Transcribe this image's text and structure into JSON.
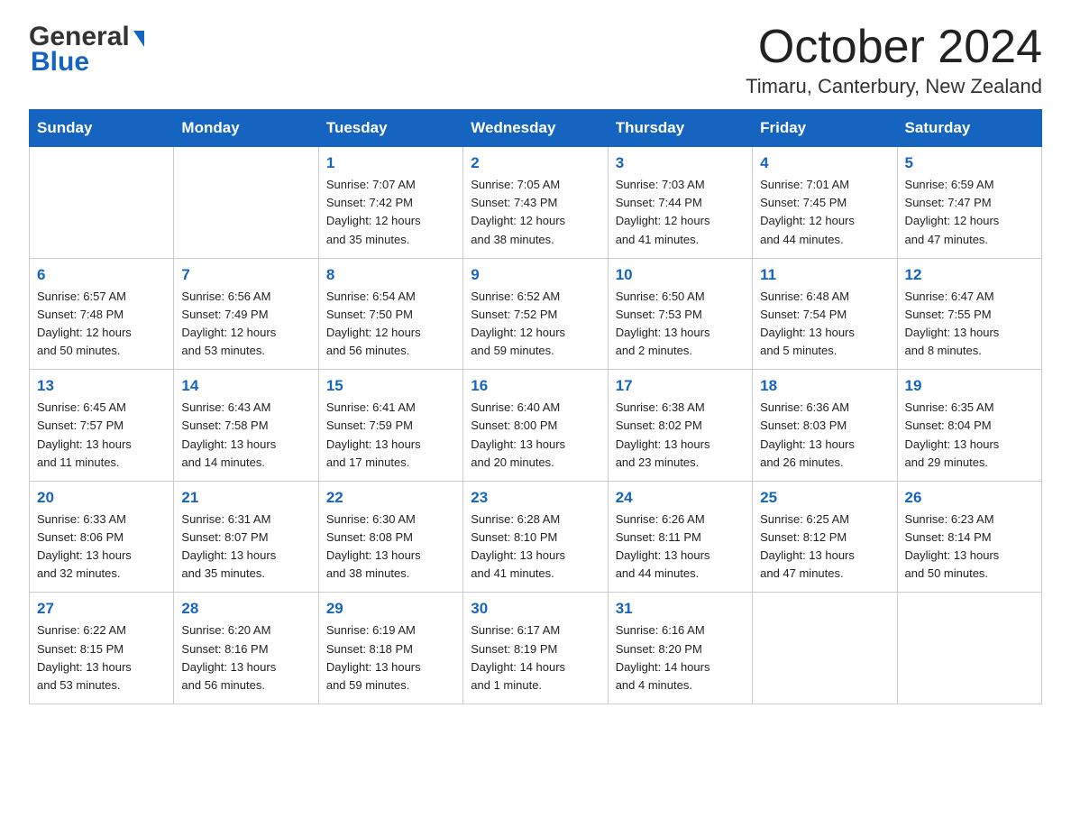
{
  "header": {
    "month_title": "October 2024",
    "location": "Timaru, Canterbury, New Zealand",
    "logo_general": "General",
    "logo_blue": "Blue"
  },
  "weekdays": [
    "Sunday",
    "Monday",
    "Tuesday",
    "Wednesday",
    "Thursday",
    "Friday",
    "Saturday"
  ],
  "weeks": [
    [
      {
        "day": "",
        "info": ""
      },
      {
        "day": "",
        "info": ""
      },
      {
        "day": "1",
        "info": "Sunrise: 7:07 AM\nSunset: 7:42 PM\nDaylight: 12 hours\nand 35 minutes."
      },
      {
        "day": "2",
        "info": "Sunrise: 7:05 AM\nSunset: 7:43 PM\nDaylight: 12 hours\nand 38 minutes."
      },
      {
        "day": "3",
        "info": "Sunrise: 7:03 AM\nSunset: 7:44 PM\nDaylight: 12 hours\nand 41 minutes."
      },
      {
        "day": "4",
        "info": "Sunrise: 7:01 AM\nSunset: 7:45 PM\nDaylight: 12 hours\nand 44 minutes."
      },
      {
        "day": "5",
        "info": "Sunrise: 6:59 AM\nSunset: 7:47 PM\nDaylight: 12 hours\nand 47 minutes."
      }
    ],
    [
      {
        "day": "6",
        "info": "Sunrise: 6:57 AM\nSunset: 7:48 PM\nDaylight: 12 hours\nand 50 minutes."
      },
      {
        "day": "7",
        "info": "Sunrise: 6:56 AM\nSunset: 7:49 PM\nDaylight: 12 hours\nand 53 minutes."
      },
      {
        "day": "8",
        "info": "Sunrise: 6:54 AM\nSunset: 7:50 PM\nDaylight: 12 hours\nand 56 minutes."
      },
      {
        "day": "9",
        "info": "Sunrise: 6:52 AM\nSunset: 7:52 PM\nDaylight: 12 hours\nand 59 minutes."
      },
      {
        "day": "10",
        "info": "Sunrise: 6:50 AM\nSunset: 7:53 PM\nDaylight: 13 hours\nand 2 minutes."
      },
      {
        "day": "11",
        "info": "Sunrise: 6:48 AM\nSunset: 7:54 PM\nDaylight: 13 hours\nand 5 minutes."
      },
      {
        "day": "12",
        "info": "Sunrise: 6:47 AM\nSunset: 7:55 PM\nDaylight: 13 hours\nand 8 minutes."
      }
    ],
    [
      {
        "day": "13",
        "info": "Sunrise: 6:45 AM\nSunset: 7:57 PM\nDaylight: 13 hours\nand 11 minutes."
      },
      {
        "day": "14",
        "info": "Sunrise: 6:43 AM\nSunset: 7:58 PM\nDaylight: 13 hours\nand 14 minutes."
      },
      {
        "day": "15",
        "info": "Sunrise: 6:41 AM\nSunset: 7:59 PM\nDaylight: 13 hours\nand 17 minutes."
      },
      {
        "day": "16",
        "info": "Sunrise: 6:40 AM\nSunset: 8:00 PM\nDaylight: 13 hours\nand 20 minutes."
      },
      {
        "day": "17",
        "info": "Sunrise: 6:38 AM\nSunset: 8:02 PM\nDaylight: 13 hours\nand 23 minutes."
      },
      {
        "day": "18",
        "info": "Sunrise: 6:36 AM\nSunset: 8:03 PM\nDaylight: 13 hours\nand 26 minutes."
      },
      {
        "day": "19",
        "info": "Sunrise: 6:35 AM\nSunset: 8:04 PM\nDaylight: 13 hours\nand 29 minutes."
      }
    ],
    [
      {
        "day": "20",
        "info": "Sunrise: 6:33 AM\nSunset: 8:06 PM\nDaylight: 13 hours\nand 32 minutes."
      },
      {
        "day": "21",
        "info": "Sunrise: 6:31 AM\nSunset: 8:07 PM\nDaylight: 13 hours\nand 35 minutes."
      },
      {
        "day": "22",
        "info": "Sunrise: 6:30 AM\nSunset: 8:08 PM\nDaylight: 13 hours\nand 38 minutes."
      },
      {
        "day": "23",
        "info": "Sunrise: 6:28 AM\nSunset: 8:10 PM\nDaylight: 13 hours\nand 41 minutes."
      },
      {
        "day": "24",
        "info": "Sunrise: 6:26 AM\nSunset: 8:11 PM\nDaylight: 13 hours\nand 44 minutes."
      },
      {
        "day": "25",
        "info": "Sunrise: 6:25 AM\nSunset: 8:12 PM\nDaylight: 13 hours\nand 47 minutes."
      },
      {
        "day": "26",
        "info": "Sunrise: 6:23 AM\nSunset: 8:14 PM\nDaylight: 13 hours\nand 50 minutes."
      }
    ],
    [
      {
        "day": "27",
        "info": "Sunrise: 6:22 AM\nSunset: 8:15 PM\nDaylight: 13 hours\nand 53 minutes."
      },
      {
        "day": "28",
        "info": "Sunrise: 6:20 AM\nSunset: 8:16 PM\nDaylight: 13 hours\nand 56 minutes."
      },
      {
        "day": "29",
        "info": "Sunrise: 6:19 AM\nSunset: 8:18 PM\nDaylight: 13 hours\nand 59 minutes."
      },
      {
        "day": "30",
        "info": "Sunrise: 6:17 AM\nSunset: 8:19 PM\nDaylight: 14 hours\nand 1 minute."
      },
      {
        "day": "31",
        "info": "Sunrise: 6:16 AM\nSunset: 8:20 PM\nDaylight: 14 hours\nand 4 minutes."
      },
      {
        "day": "",
        "info": ""
      },
      {
        "day": "",
        "info": ""
      }
    ]
  ]
}
